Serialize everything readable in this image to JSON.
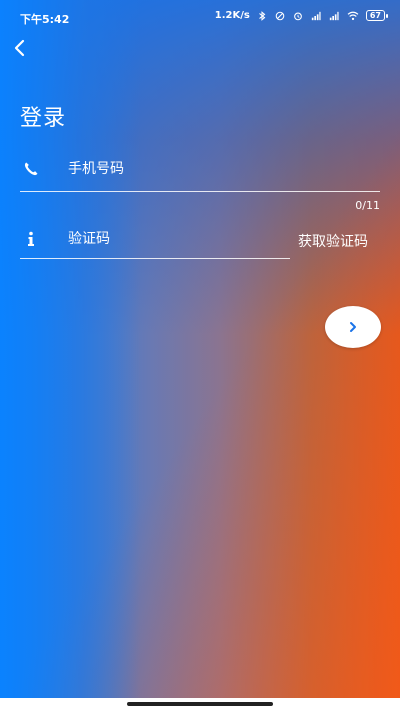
{
  "status_bar": {
    "time": "下午5:42",
    "network_speed": "1.2K/s",
    "battery": "67",
    "icons": [
      "bluetooth-icon",
      "dnd-icon",
      "alarm-icon",
      "sim1-signal-icon",
      "sim2-signal-icon",
      "wifi-icon",
      "battery-icon"
    ]
  },
  "nav": {
    "back_icon": "chevron-left-icon"
  },
  "page": {
    "title": "登录"
  },
  "form": {
    "phone": {
      "icon": "phone-icon",
      "placeholder": "手机号码",
      "value": "",
      "counter": "0/11"
    },
    "code": {
      "icon": "info-icon",
      "placeholder": "验证码",
      "value": "",
      "get_code_label": "获取验证码"
    },
    "submit": {
      "icon": "chevron-right-icon"
    }
  },
  "colors": {
    "gradient_blue": "#1480f2",
    "gradient_orange": "#e0581f",
    "accent_blue": "#1a73e8",
    "text": "#ffffff"
  }
}
